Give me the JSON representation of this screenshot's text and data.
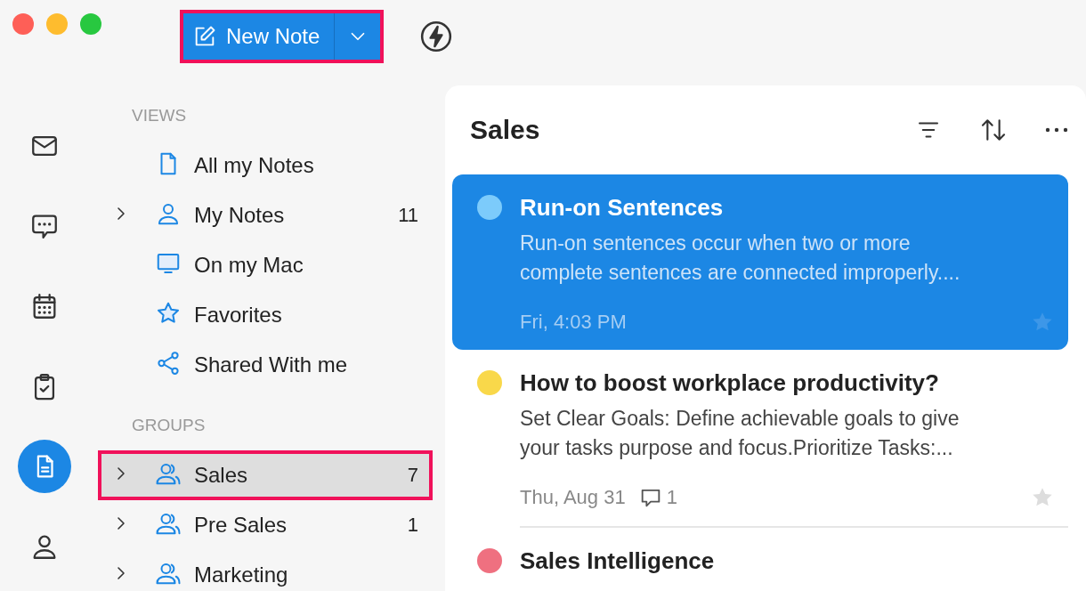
{
  "toolbar": {
    "new_note": {
      "label": "New Note",
      "highlighted": true
    }
  },
  "rail": [
    {
      "kind": "mail",
      "selected": false
    },
    {
      "kind": "chat",
      "selected": false
    },
    {
      "kind": "calendar",
      "selected": false
    },
    {
      "kind": "tasks",
      "selected": false
    },
    {
      "kind": "notes",
      "selected": true
    },
    {
      "kind": "contacts",
      "selected": false
    }
  ],
  "sidebar": {
    "sections": [
      {
        "title": "VIEWS",
        "items": [
          {
            "kind": "doc",
            "label": "All my Notes",
            "expandable": false,
            "selected": false,
            "highlighted": false
          },
          {
            "kind": "person",
            "label": "My Notes",
            "count": "11",
            "expandable": true,
            "selected": false,
            "highlighted": false
          },
          {
            "kind": "monitor",
            "label": "On my Mac",
            "expandable": false,
            "selected": false,
            "highlighted": false
          },
          {
            "kind": "star",
            "label": "Favorites",
            "expandable": false,
            "selected": false,
            "highlighted": false
          },
          {
            "kind": "share",
            "label": "Shared With me",
            "expandable": false,
            "selected": false,
            "highlighted": false
          }
        ]
      },
      {
        "title": "GROUPS",
        "items": [
          {
            "kind": "group",
            "label": "Sales",
            "count": "7",
            "expandable": true,
            "selected": true,
            "highlighted": true
          },
          {
            "kind": "group",
            "label": "Pre Sales",
            "count": "1",
            "expandable": true,
            "selected": false,
            "highlighted": false
          },
          {
            "kind": "group",
            "label": "Marketing",
            "expandable": true,
            "selected": false,
            "highlighted": false
          }
        ]
      }
    ]
  },
  "notes_panel": {
    "title": "Sales",
    "notes": [
      {
        "title": "Run-on Sentences",
        "preview_lines": [
          "Run-on sentences occur when two or more",
          "complete sentences are connected improperly...."
        ],
        "date": "Fri, 4:03 PM",
        "color": "#7ccbfb",
        "selected": true,
        "favorite": false
      },
      {
        "title": "How to boost workplace productivity?",
        "preview_lines": [
          "Set Clear Goals: Define achievable goals to give",
          "your tasks purpose and focus.Prioritize Tasks:..."
        ],
        "date": "Thu, Aug 31",
        "comments": "1",
        "color": "#f9d84a",
        "selected": false,
        "favorite": false
      },
      {
        "title": "Sales Intelligence",
        "color": "#ef7080",
        "selected": false
      }
    ]
  }
}
